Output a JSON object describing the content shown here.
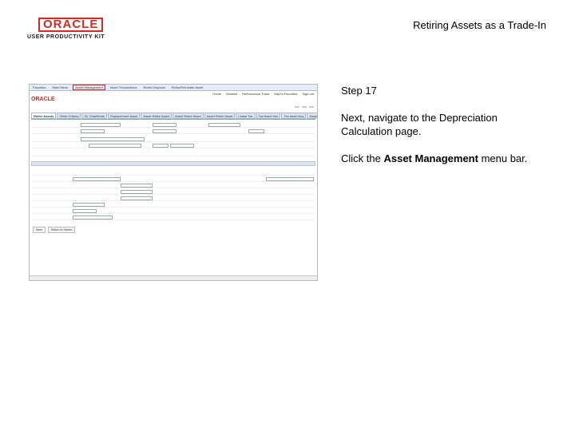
{
  "header": {
    "logo_text": "ORACLE",
    "logo_sub": "USER PRODUCTIVITY KIT",
    "page_title": "Retiring Assets as a Trade-In"
  },
  "instructions": {
    "step": "Step 17",
    "text": "Next, navigate to the Depreciation Calculation page.",
    "click_prefix": "Click the ",
    "click_target": "Asset Management",
    "click_suffix": " menu bar."
  },
  "screenshot": {
    "menu_items": [
      "Favorites",
      "Main Menu",
      "Asset Management",
      "Asset Transactions",
      "Retire Disposal",
      "Retire/Reinstate Asset"
    ],
    "active_menu": "Asset Management",
    "top_links": [
      "Home",
      "Worklist",
      "Performance Trace",
      "Add to Favorites",
      "Sign out"
    ],
    "brand": "ORACLE",
    "tabs": [
      "Retire Assets",
      "Other Criteria",
      "GL Chartfields",
      "Replacement Asset",
      "Asset Retire Asset",
      "Asset Retire Asset",
      "Asset Retire Asset",
      "Lease Tax",
      "Tax Asset Info",
      "Tax Asset Acq",
      "Asset Entity"
    ],
    "selected_tab": "Retire Assets",
    "buttons": [
      "Save",
      "Return to Search"
    ]
  }
}
